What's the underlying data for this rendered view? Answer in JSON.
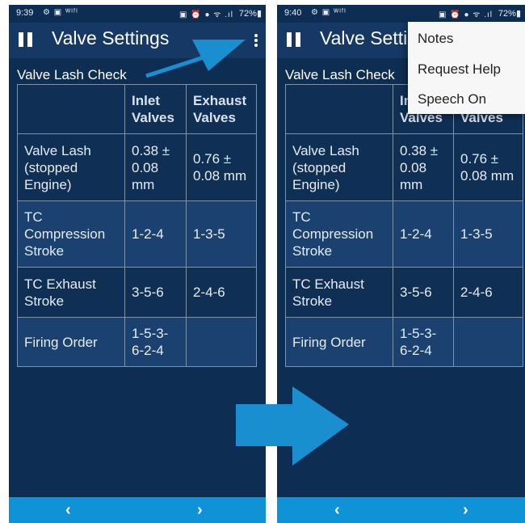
{
  "screens": [
    {
      "status": {
        "time": "9:39",
        "left_icons": "⚙ ▣ ᵂᴵᶠᴵ",
        "right_icons": "▣ ⏰ ● ᯤ .ıl",
        "battery": "72%▮"
      },
      "app_title": "Valve Settings",
      "section_title": "Valve Lash Check"
    },
    {
      "status": {
        "time": "9:40",
        "left_icons": "⚙ ▣ ᵂᴵᶠᴵ",
        "right_icons": "▣ ⏰ ● ᯤ .ıl",
        "battery": "72%▮"
      },
      "app_title": "Valve Setti",
      "section_title": "Valve Lash Check"
    }
  ],
  "table": {
    "headers": [
      "",
      "Inlet Valves",
      "Exhaust Valves"
    ],
    "rows": [
      [
        "Valve Lash (stopped Engine)",
        "0.38 ± 0.08 mm",
        "0.76 ± 0.08 mm"
      ],
      [
        "TC Compression Stroke",
        "1-2-4",
        "1-3-5"
      ],
      [
        "TC Exhaust Stroke",
        "3-5-6",
        "2-4-6"
      ],
      [
        "Firing Order",
        "1-5-3-6-2-4",
        ""
      ]
    ]
  },
  "overflow_menu": [
    "Notes",
    "Request Help",
    "Speech On"
  ],
  "nav": {
    "back": "‹",
    "forward": "›"
  },
  "colors": {
    "background": "#0e2d52",
    "appbar": "#163865",
    "navbar": "#0f93d6",
    "arrow": "#1a8fd0"
  }
}
